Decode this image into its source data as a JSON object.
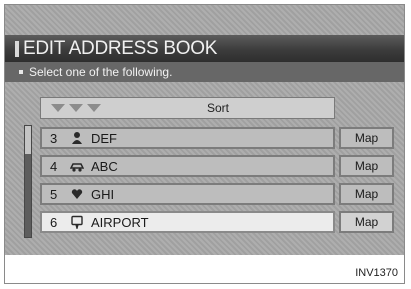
{
  "screen": {
    "title": "EDIT ADDRESS BOOK",
    "subtitle": "Select one of the following.",
    "sort_label": "Sort",
    "rows": [
      {
        "num": "3",
        "icon": "person-icon",
        "name": "DEF",
        "map_label": "Map",
        "selected": false
      },
      {
        "num": "4",
        "icon": "car-icon",
        "name": "ABC",
        "map_label": "Map",
        "selected": false
      },
      {
        "num": "5",
        "icon": "heart-icon",
        "name": "GHI",
        "map_label": "Map",
        "selected": false
      },
      {
        "num": "6",
        "icon": "speech-bubble-icon",
        "name": "AIRPORT",
        "map_label": "Map",
        "selected": true
      }
    ]
  },
  "caption": "INV1370"
}
